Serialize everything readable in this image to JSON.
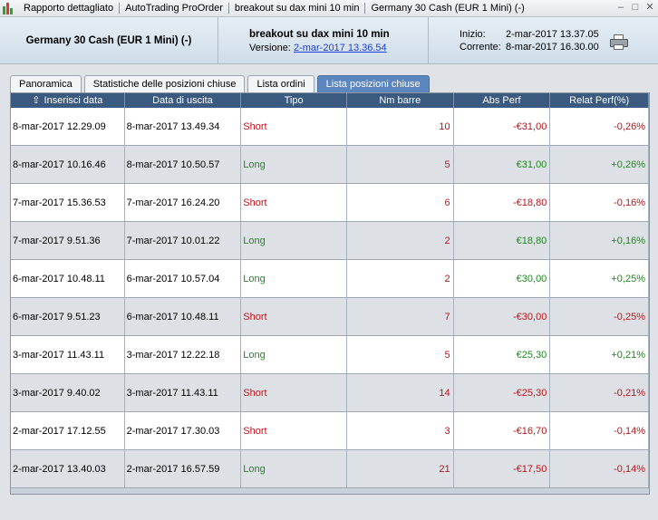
{
  "window": {
    "title_parts": [
      "Rapporto dettagliato",
      "AutoTrading ProOrder",
      "breakout su dax mini  10 min",
      "Germany 30 Cash (EUR 1 Mini) (-)"
    ],
    "controls": [
      "–",
      "□",
      "✕"
    ]
  },
  "info": {
    "instrument": "Germany 30 Cash (EUR 1 Mini) (-)",
    "strategy": "breakout su dax mini  10 min",
    "version_label": "Versione:",
    "version_value": "2-mar-2017 13.36.54",
    "start_label": "Inizio:",
    "start_value": "2-mar-2017 13.37.05",
    "current_label": "Corrente:",
    "current_value": "8-mar-2017 16.30.00"
  },
  "tabs": [
    {
      "label": "Panoramica",
      "active": false
    },
    {
      "label": "Statistiche delle posizioni chiuse",
      "active": false
    },
    {
      "label": "Lista ordini",
      "active": false
    },
    {
      "label": "Lista posizioni chiuse",
      "active": true
    }
  ],
  "table": {
    "sort_icon": "up-arrow-icon",
    "columns": [
      "Inserisci data",
      "Data di uscita",
      "Tipo",
      "Nm barre",
      "Abs Perf",
      "Relat Perf(%)"
    ],
    "rows": [
      {
        "entry": "8-mar-2017 12.29.09",
        "exit": "8-mar-2017 13.49.34",
        "type": "Short",
        "bars": "10",
        "abs": "-€31,00",
        "rel": "-0,26%"
      },
      {
        "entry": "8-mar-2017 10.16.46",
        "exit": "8-mar-2017 10.50.57",
        "type": "Long",
        "bars": "5",
        "abs": "€31,00",
        "rel": "+0,26%"
      },
      {
        "entry": "7-mar-2017 15.36.53",
        "exit": "7-mar-2017 16.24.20",
        "type": "Short",
        "bars": "6",
        "abs": "-€18,80",
        "rel": "-0,16%"
      },
      {
        "entry": "7-mar-2017 9.51.36",
        "exit": "7-mar-2017 10.01.22",
        "type": "Long",
        "bars": "2",
        "abs": "€18,80",
        "rel": "+0,16%"
      },
      {
        "entry": "6-mar-2017 10.48.11",
        "exit": "6-mar-2017 10.57.04",
        "type": "Long",
        "bars": "2",
        "abs": "€30,00",
        "rel": "+0,25%"
      },
      {
        "entry": "6-mar-2017 9.51.23",
        "exit": "6-mar-2017 10.48.11",
        "type": "Short",
        "bars": "7",
        "abs": "-€30,00",
        "rel": "-0,25%"
      },
      {
        "entry": "3-mar-2017 11.43.11",
        "exit": "3-mar-2017 12.22.18",
        "type": "Long",
        "bars": "5",
        "abs": "€25,30",
        "rel": "+0,21%"
      },
      {
        "entry": "3-mar-2017 9.40.02",
        "exit": "3-mar-2017 11.43.11",
        "type": "Short",
        "bars": "14",
        "abs": "-€25,30",
        "rel": "-0,21%"
      },
      {
        "entry": "2-mar-2017 17.12.55",
        "exit": "2-mar-2017 17.30.03",
        "type": "Short",
        "bars": "3",
        "abs": "-€16,70",
        "rel": "-0,14%"
      },
      {
        "entry": "2-mar-2017 13.40.03",
        "exit": "2-mar-2017 16.57.59",
        "type": "Long",
        "bars": "21",
        "abs": "-€17,50",
        "rel": "-0,14%"
      }
    ]
  },
  "colors": {
    "negative": "#b8161b",
    "positive": "#1e8a1e",
    "header": "#3b5a80",
    "active_tab": "#5c86bf"
  }
}
